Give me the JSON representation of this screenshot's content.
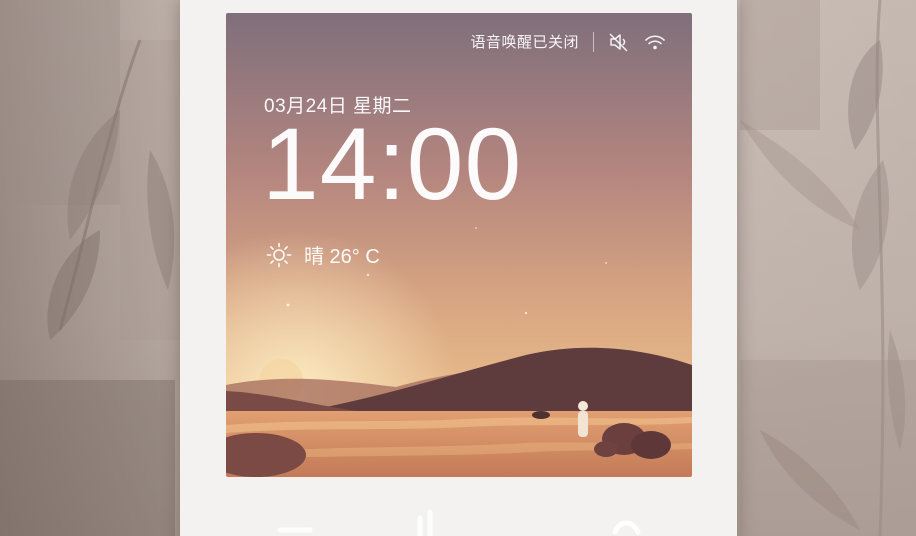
{
  "status_bar": {
    "voice_wakeup_text": "语音唤醒已关闭",
    "mute_icon": "speaker-muted-icon",
    "wifi_icon": "wifi-icon"
  },
  "clock": {
    "date": "03月24日 星期二",
    "time": "14:00"
  },
  "weather": {
    "icon": "sun-icon",
    "text": "晴 26° C"
  },
  "colors": {
    "sky_top": "#8c7a86",
    "sky_mid": "#c99a8c",
    "sky_low": "#e5b58a",
    "hill_dark": "#5e3c3e",
    "hill_mid": "#8d5a55",
    "ground": "#c98a62",
    "device_frame": "#f4f2f1"
  }
}
